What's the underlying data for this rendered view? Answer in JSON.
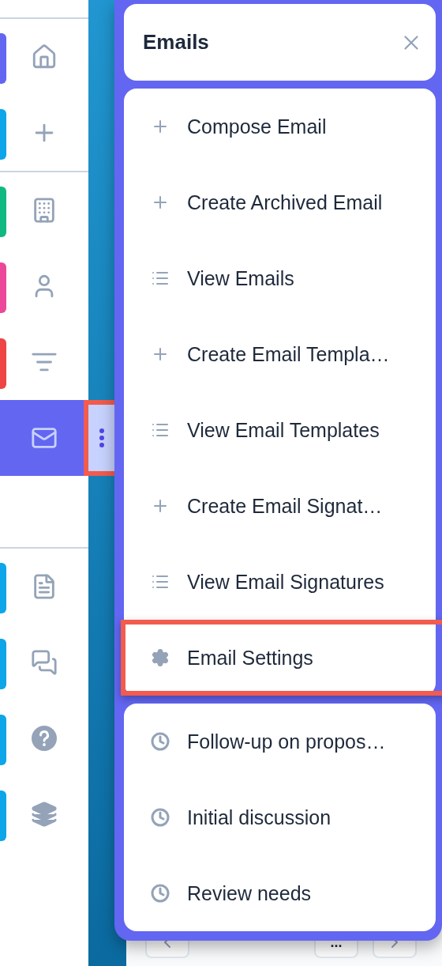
{
  "sidebar": {
    "groups": [
      {
        "items": [
          {
            "color": "#6366f1",
            "selected": false
          },
          {
            "color": "#0ea5e9",
            "selected": false
          }
        ]
      },
      {
        "items": [
          {
            "color": "#10b981",
            "selected": false
          },
          {
            "color": "#ec4899",
            "selected": false
          },
          {
            "color": "#ef4444",
            "selected": false
          },
          {
            "selected": true,
            "menu_button": {
              "highlighted": true
            }
          }
        ]
      },
      {
        "items": [
          {
            "color": "#0ea5e9",
            "selected": false
          },
          {
            "color": "#0ea5e9",
            "selected": false
          },
          {
            "color": "#0ea5e9",
            "selected": false
          },
          {
            "color": "#0ea5e9",
            "selected": false
          }
        ]
      }
    ]
  },
  "pagination": {
    "more": "..."
  },
  "popup": {
    "title": "Emails",
    "sections": [
      {
        "items": [
          {
            "kind": "create",
            "label": "Compose Email",
            "highlighted": false
          },
          {
            "kind": "create",
            "label": "Create Archived Email",
            "highlighted": false
          },
          {
            "kind": "list",
            "label": "View Emails",
            "highlighted": false
          },
          {
            "kind": "create",
            "label": "Create Email Templa…",
            "highlighted": false
          },
          {
            "kind": "list",
            "label": "View Email Templates",
            "highlighted": false
          },
          {
            "kind": "create",
            "label": "Create Email Signat…",
            "highlighted": false
          },
          {
            "kind": "list",
            "label": "View Email Signatures",
            "highlighted": false
          },
          {
            "kind": "settings",
            "label": "Email Settings",
            "highlighted": true
          }
        ]
      },
      {
        "items": [
          {
            "kind": "recent",
            "label": "Follow-up on propos…",
            "highlighted": false
          },
          {
            "kind": "recent",
            "label": "Initial discussion",
            "highlighted": false
          },
          {
            "kind": "recent",
            "label": "Review needs",
            "highlighted": false
          }
        ]
      }
    ]
  }
}
